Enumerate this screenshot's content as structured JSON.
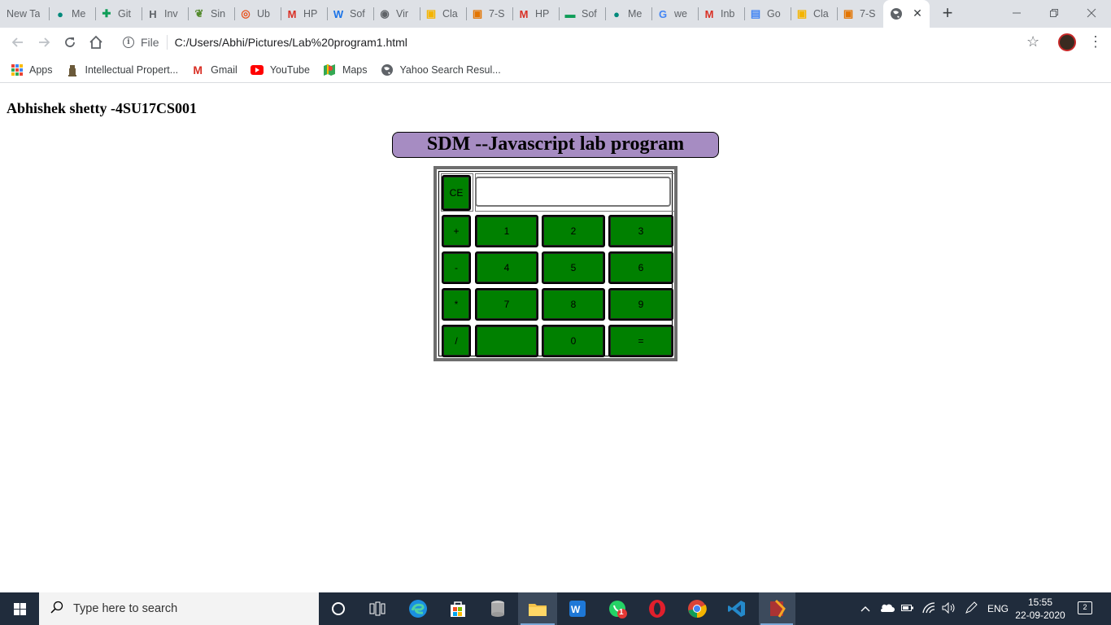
{
  "tabs": [
    {
      "label": "New Ta",
      "icon": "generic-page-icon",
      "color": "#dee1e6"
    },
    {
      "label": "Me",
      "icon": "meet-icon",
      "color": "#00897b"
    },
    {
      "label": "Git",
      "icon": "sheets-icon",
      "color": "#0f9d58"
    },
    {
      "label": "Inv",
      "icon": "h-logo-icon",
      "color": "#5f6368"
    },
    {
      "label": "Sin",
      "icon": "leaf-icon",
      "color": "#558b2f"
    },
    {
      "label": "Ub",
      "icon": "ubuntu-icon",
      "color": "#e95420"
    },
    {
      "label": "HP",
      "icon": "gmail-icon",
      "color": "#d93025"
    },
    {
      "label": "Sof",
      "icon": "w-logo-icon",
      "color": "#1a73e8"
    },
    {
      "label": "Vir",
      "icon": "globe-icon",
      "color": "#5f6368"
    },
    {
      "label": "Cla",
      "icon": "classroom-icon",
      "color": "#f4b400"
    },
    {
      "label": "7-S",
      "icon": "classroom-icon",
      "color": "#e37400"
    },
    {
      "label": "HP",
      "icon": "gmail-icon",
      "color": "#d93025"
    },
    {
      "label": "Sof",
      "icon": "dash-icon",
      "color": "#0f9d58"
    },
    {
      "label": "Me",
      "icon": "meet-icon",
      "color": "#00897b"
    },
    {
      "label": "we",
      "icon": "google-icon",
      "color": "#4285f4"
    },
    {
      "label": "Inb",
      "icon": "gmail-icon",
      "color": "#d93025"
    },
    {
      "label": "Go",
      "icon": "forms-icon",
      "color": "#4285f4"
    },
    {
      "label": "Cla",
      "icon": "classroom-icon",
      "color": "#f4b400"
    },
    {
      "label": "7-S",
      "icon": "classroom-icon",
      "color": "#e37400"
    }
  ],
  "active_tab_icon": "globe-icon",
  "address": {
    "scheme_label": "File",
    "url": "C:/Users/Abhi/Pictures/Lab%20program1.html"
  },
  "bookmarks": [
    {
      "label": "Apps",
      "icon": "apps-grid-icon"
    },
    {
      "label": "Intellectual Propert...",
      "icon": "emblem-icon"
    },
    {
      "label": "Gmail",
      "icon": "gmail-icon"
    },
    {
      "label": "YouTube",
      "icon": "youtube-icon"
    },
    {
      "label": "Maps",
      "icon": "maps-icon"
    },
    {
      "label": "Yahoo Search Resul...",
      "icon": "globe-icon"
    }
  ],
  "page": {
    "author": "Abhishek shetty -4SU17CS001",
    "heading": "SDM --Javascript lab program",
    "display_value": "",
    "keys": {
      "clear": "CE",
      "row1": [
        "+",
        "1",
        "2",
        "3"
      ],
      "row2": [
        "-",
        "4",
        "5",
        "6"
      ],
      "row3": [
        "*",
        "7",
        "8",
        "9"
      ],
      "row4": [
        "/",
        "",
        "0",
        "="
      ]
    }
  },
  "taskbar": {
    "search_placeholder": "Type here to search",
    "whatsapp_badge": "1",
    "language": "ENG",
    "time": "15:55",
    "date": "22-09-2020",
    "notification_count": "2"
  },
  "colors": {
    "heading_bg": "#a68cc2",
    "key_bg": "#008000",
    "taskbar_bg": "#202c3c"
  }
}
